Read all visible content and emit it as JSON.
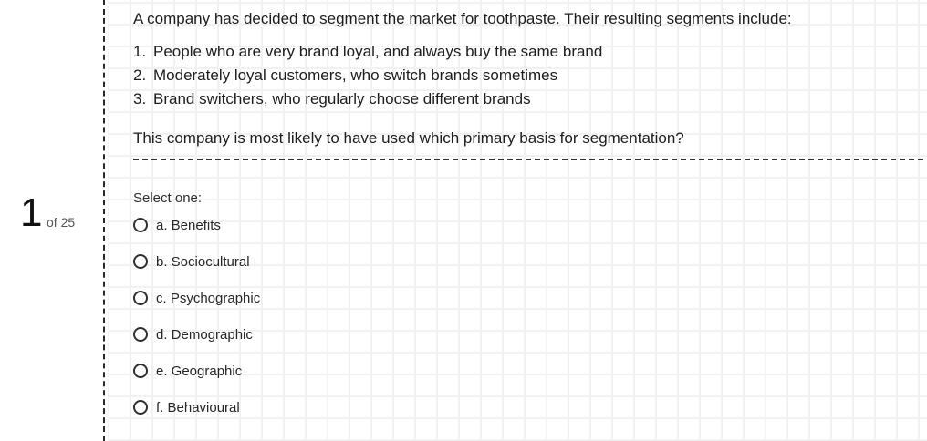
{
  "question": {
    "number": "1",
    "of_label": "of 25",
    "intro": "A company has decided to segment the market for toothpaste. Their resulting segments include:",
    "segments": [
      {
        "num": "1.",
        "text": "People who are very brand loyal, and always buy the same brand"
      },
      {
        "num": "2.",
        "text": "Moderately loyal customers, who switch brands sometimes"
      },
      {
        "num": "3.",
        "text": "Brand switchers, who regularly choose different brands"
      }
    ],
    "prompt": "This company is most likely to have used which primary basis for segmentation?",
    "select_label": "Select one:",
    "options": [
      "a. Benefits",
      "b. Sociocultural",
      "c. Psychographic",
      "d. Demographic",
      "e. Geographic",
      "f. Behavioural"
    ]
  },
  "icons": {
    "radio": "radio-circle-icon"
  }
}
